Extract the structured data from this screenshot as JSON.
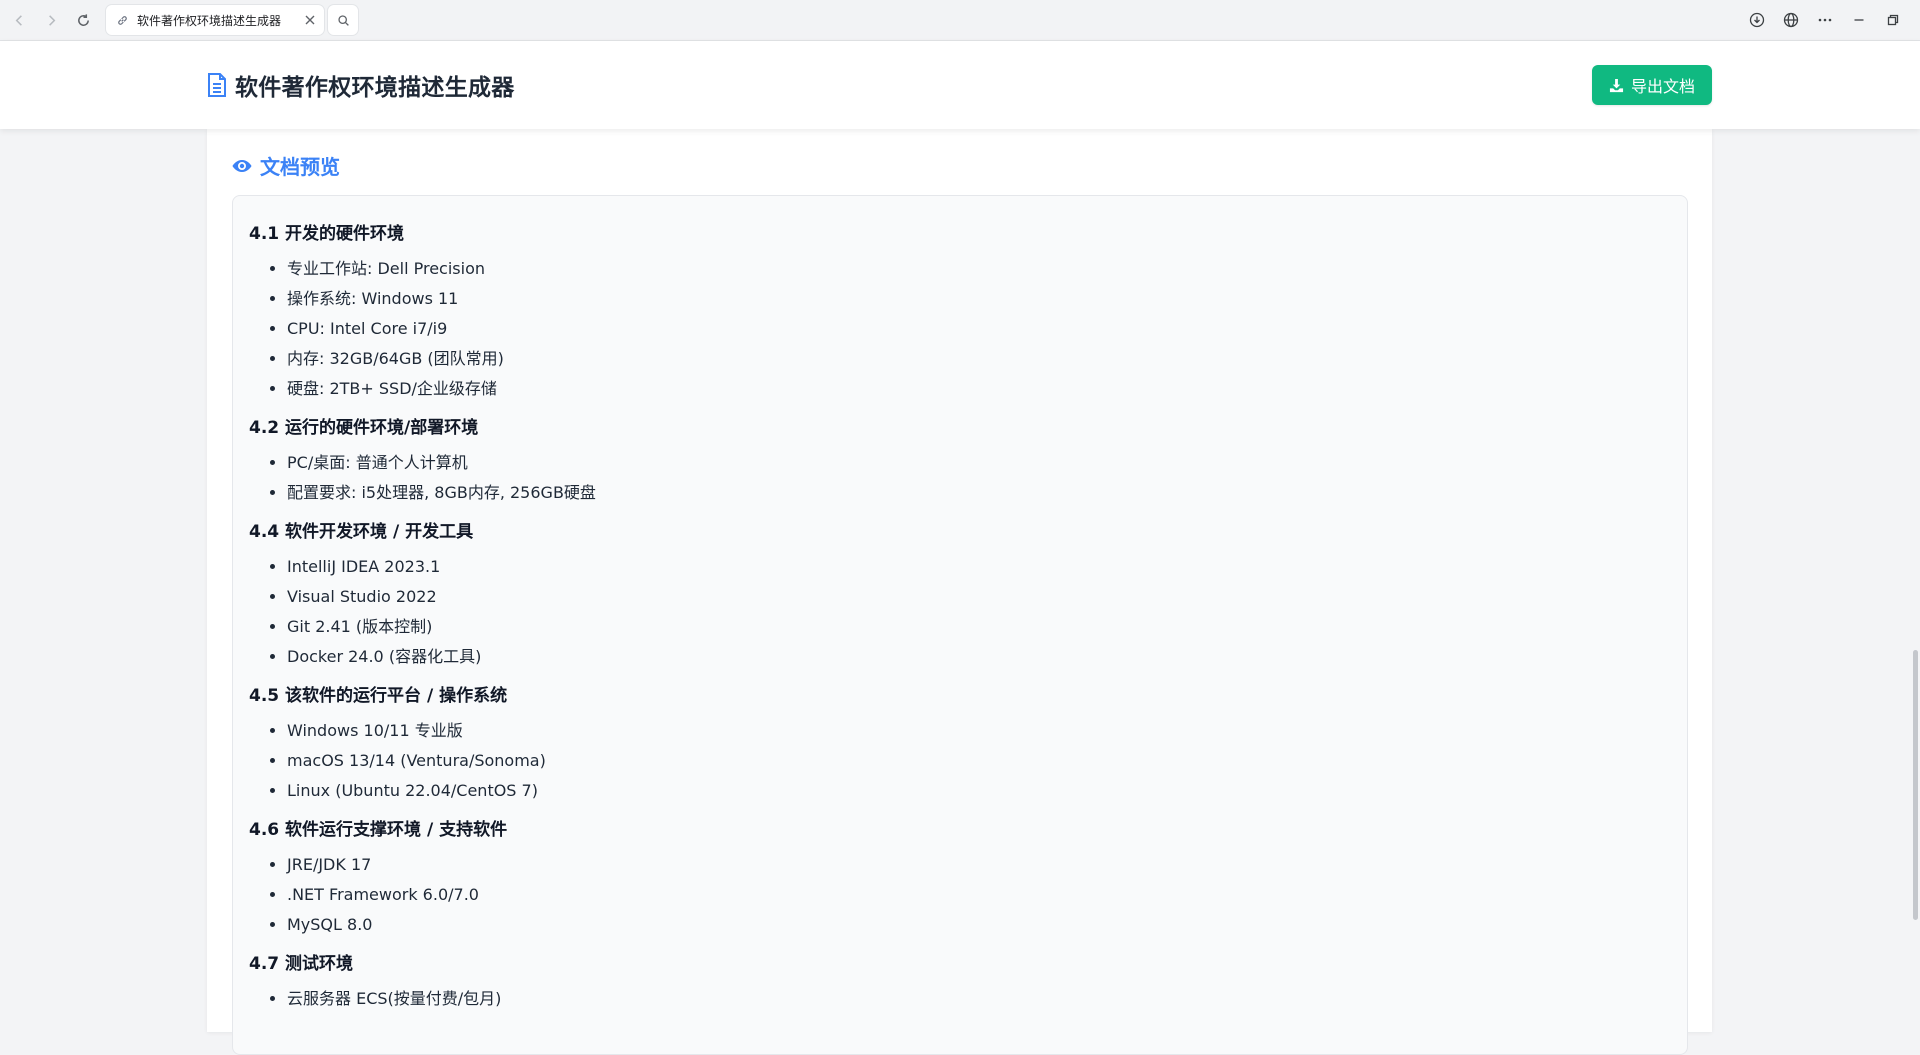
{
  "browser": {
    "tab_title": "软件著作权环境描述生成器"
  },
  "header": {
    "app_title": "软件著作权环境描述生成器",
    "export_label": "导出文档"
  },
  "preview": {
    "section_title": "文档预览",
    "sections": [
      {
        "heading": "4.1 开发的硬件环境",
        "items": [
          "专业工作站: Dell Precision",
          "操作系统: Windows 11",
          "CPU: Intel Core i7/i9",
          "内存: 32GB/64GB (团队常用)",
          "硬盘: 2TB+ SSD/企业级存储"
        ]
      },
      {
        "heading": "4.2 运行的硬件环境/部署环境",
        "items": [
          "PC/桌面: 普通个人计算机",
          "配置要求: i5处理器, 8GB内存, 256GB硬盘"
        ]
      },
      {
        "heading": "4.4 软件开发环境 / 开发工具",
        "items": [
          "IntelliJ IDEA 2023.1",
          "Visual Studio 2022",
          "Git 2.41 (版本控制)",
          "Docker 24.0 (容器化工具)"
        ]
      },
      {
        "heading": "4.5 该软件的运行平台 / 操作系统",
        "items": [
          "Windows 10/11 专业版",
          "macOS 13/14 (Ventura/Sonoma)",
          "Linux (Ubuntu 22.04/CentOS 7)"
        ]
      },
      {
        "heading": "4.6 软件运行支撑环境 / 支持软件",
        "items": [
          "JRE/JDK 17",
          ".NET Framework 6.0/7.0",
          "MySQL 8.0"
        ]
      },
      {
        "heading": "4.7 测试环境",
        "items": [
          "云服务器 ECS(按量付费/包月)"
        ]
      }
    ]
  },
  "colors": {
    "accent": "#3b82f6",
    "export_button": "#10b981"
  },
  "icons": {
    "back": "arrow-left-icon",
    "forward": "arrow-right-icon",
    "reload": "reload-icon",
    "tab": "link-icon",
    "close": "close-icon",
    "search": "search-icon",
    "download": "download-icon",
    "globe": "globe-icon",
    "more": "more-icon",
    "minimize": "minimize-icon",
    "restore": "restore-icon",
    "document": "document-icon",
    "export": "download-icon",
    "preview": "eye-icon"
  }
}
